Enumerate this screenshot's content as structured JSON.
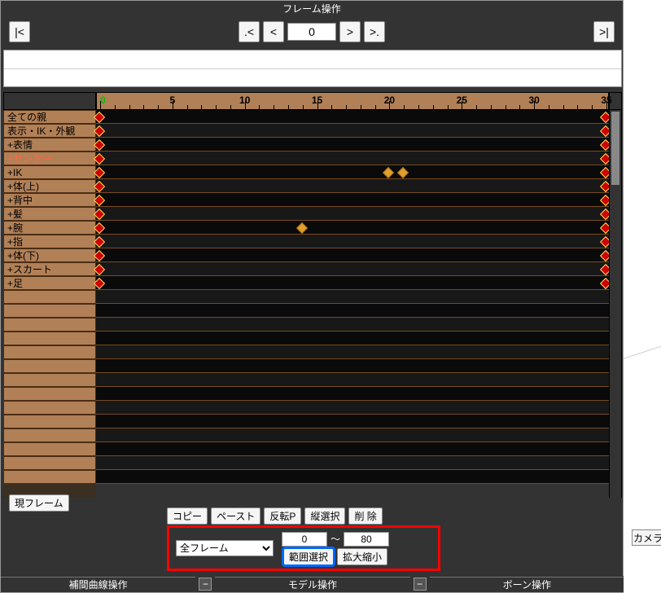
{
  "title": "フレーム操作",
  "nav": {
    "first": "|<",
    "prevkey": ".<",
    "prev": "<",
    "next": ">",
    "nextkey": ">.",
    "last": ">|",
    "current_frame": "0"
  },
  "ruler": {
    "labels": [
      "0",
      "5",
      "10",
      "15",
      "20",
      "25",
      "30",
      "35"
    ],
    "max": 35
  },
  "bones": [
    {
      "label": "全ての親",
      "selected": false,
      "keys": [
        0,
        35
      ]
    },
    {
      "label": "表示・IK・外観",
      "selected": false,
      "keys": [
        0,
        35
      ]
    },
    {
      "label": "+表情",
      "selected": false,
      "keys": [
        0,
        35
      ]
    },
    {
      "label": "+センター",
      "selected": true,
      "keys": [
        0,
        35
      ]
    },
    {
      "label": "+IK",
      "selected": false,
      "keys": [
        0,
        20,
        21,
        35
      ]
    },
    {
      "label": "+体(上)",
      "selected": false,
      "keys": [
        0,
        35
      ]
    },
    {
      "label": "+背中",
      "selected": false,
      "keys": [
        0,
        35
      ]
    },
    {
      "label": "+髪",
      "selected": false,
      "keys": [
        0,
        35
      ]
    },
    {
      "label": "+腕",
      "selected": false,
      "keys": [
        0,
        14,
        35
      ]
    },
    {
      "label": "+指",
      "selected": false,
      "keys": [
        0,
        35
      ]
    },
    {
      "label": "+体(下)",
      "selected": false,
      "keys": [
        0,
        35
      ]
    },
    {
      "label": "+スカート",
      "selected": false,
      "keys": [
        0,
        35
      ]
    },
    {
      "label": "+足",
      "selected": false,
      "keys": [
        0,
        35
      ]
    }
  ],
  "empty_rows": 14,
  "bottom": {
    "current_frame_btn": "現フレーム",
    "copy": "コピー",
    "paste": "ペースト",
    "flip_paste": "反転P",
    "vselect": "縦選択",
    "delete": "削  除",
    "select_label": "全フレーム",
    "range_start": "0",
    "range_end": "80",
    "tilde": "～",
    "range_select": "範囲選択",
    "scale": "拡大縮小"
  },
  "footer": {
    "section1": "補間曲線操作",
    "section2": "モデル操作",
    "section3": "ボーン操作",
    "collapse": "−"
  },
  "side": {
    "camera_btn": "カメラ"
  }
}
